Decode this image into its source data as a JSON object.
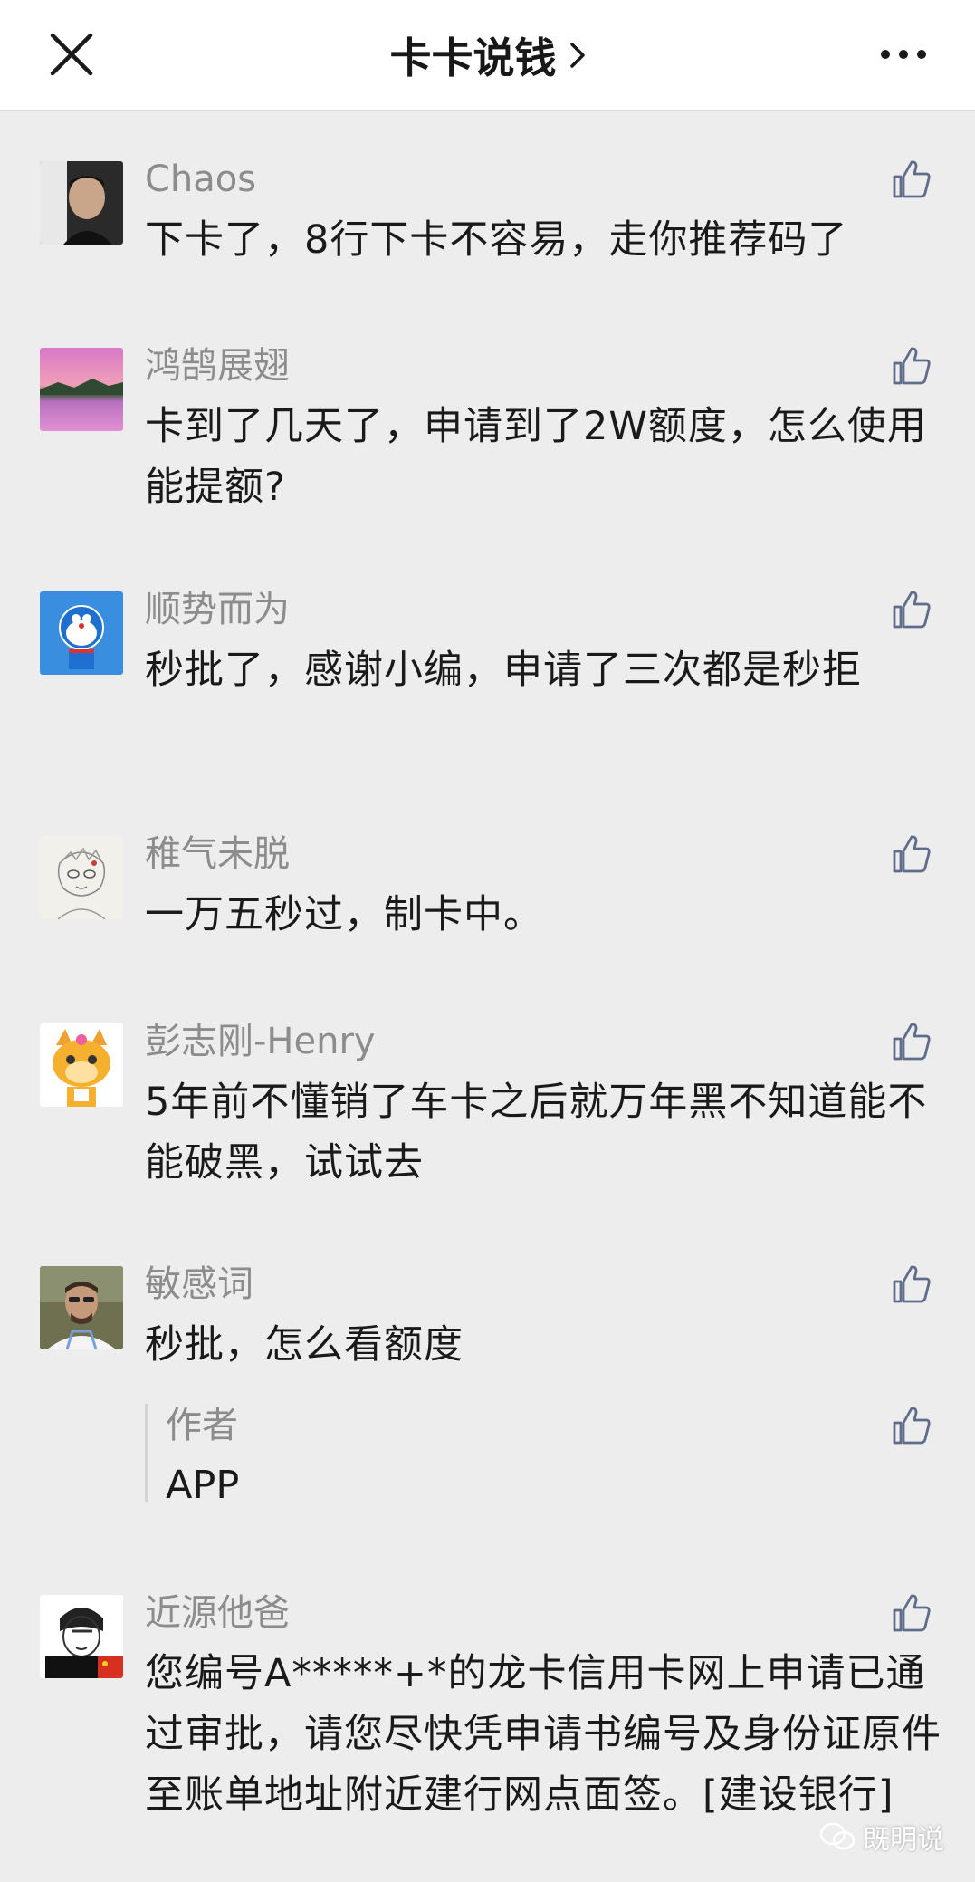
{
  "header": {
    "title": "卡卡说钱",
    "close_icon": "close-icon",
    "more_icon": "more-icon"
  },
  "comments": [
    {
      "name": "Chaos",
      "text": "下卡了，8行下卡不容易，走你推荐码了",
      "avatar": "avatar-man-dark"
    },
    {
      "name": "鸿鹄展翅",
      "text": "卡到了几天了，申请到了2W额度，怎么使用能提额?",
      "avatar": "avatar-sunset-lake"
    },
    {
      "name": "顺势而为",
      "text": "秒批了，感谢小编，申请了三次都是秒拒",
      "avatar": "avatar-blue-cartoon"
    },
    {
      "name": "稚气未脱",
      "text": "一万五秒过，制卡中。",
      "avatar": "avatar-sketch"
    },
    {
      "name": "彭志刚-Henry",
      "text": "5年前不懂销了车卡之后就万年黑不知道能不能破黑，试试去",
      "avatar": "avatar-orange-cat"
    },
    {
      "name": "敏感词",
      "text": "秒批，怎么看额度",
      "avatar": "avatar-man-glasses",
      "reply": {
        "label": "作者",
        "text": "APP"
      }
    },
    {
      "name": "近源他爸",
      "text": "您编号A*****+*的龙卡信用卡网上申请已通过审批，请您尽快凭申请书编号及身份证原件至账单地址附近建行网点面签。[建设银行]",
      "avatar": "avatar-sketch-flag"
    }
  ],
  "watermark": "既明说",
  "colors": {
    "background": "#ededed",
    "name": "#8c8c8c",
    "text": "#1a1a1a",
    "like_icon": "#5f6d8a"
  }
}
